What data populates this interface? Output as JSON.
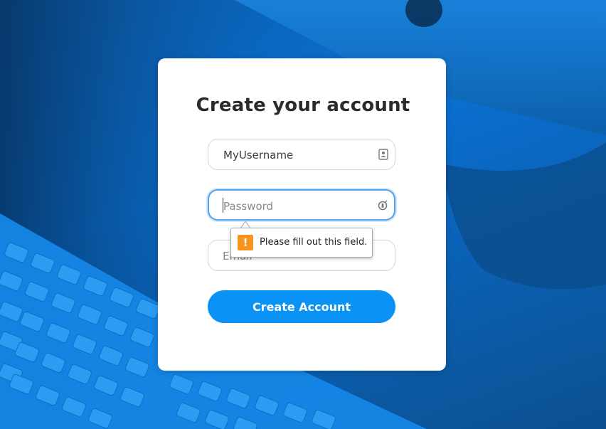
{
  "page": {
    "title": "Create your account"
  },
  "form": {
    "username": {
      "value": "MyUsername",
      "placeholder": "Username",
      "icon": "contact-card-icon"
    },
    "password": {
      "value": "",
      "placeholder": "Password",
      "icon": "password-manager-icon"
    },
    "email": {
      "value": "",
      "placeholder": "Email"
    },
    "submit_label": "Create Account"
  },
  "validation": {
    "message": "Please fill out this field.",
    "icon": "warning-icon",
    "icon_glyph": "!"
  },
  "colors": {
    "accent": "#0a93f5",
    "focus_border": "#4fa3f3",
    "warning": "#f7941e"
  }
}
